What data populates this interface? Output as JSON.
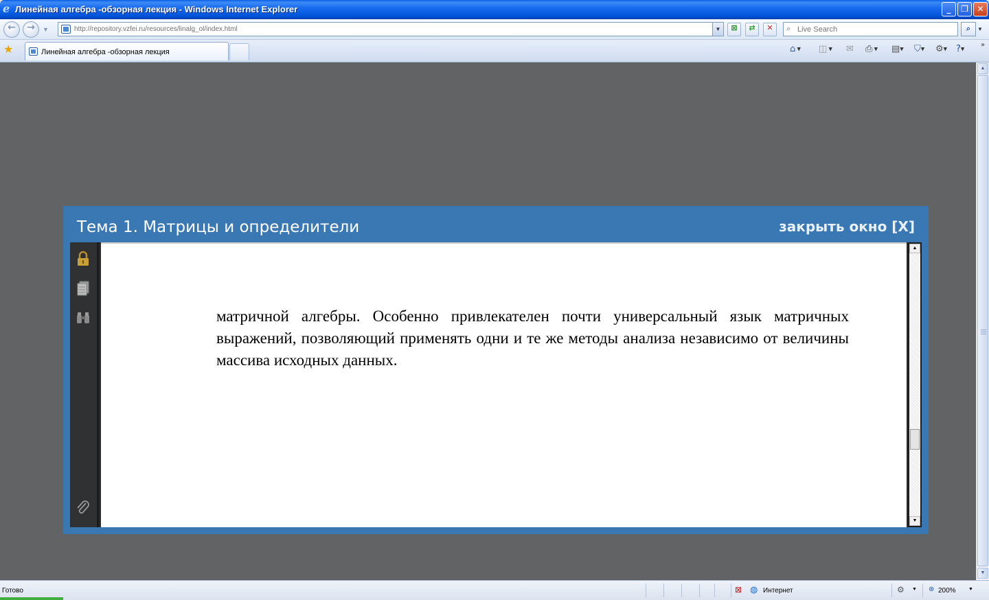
{
  "window": {
    "title": "Линейная алгебра -обзорная лекция - Windows Internet Explorer",
    "minimize_glyph": "_",
    "maximize_glyph": "❐",
    "close_glyph": "✕"
  },
  "address_bar": {
    "url": "http://repository.vzfei.ru/resources/linalg_ol/index.html",
    "search_placeholder": "Live Search"
  },
  "tabs": [
    {
      "label": "Линейная алгебра -обзорная лекция",
      "active": true
    }
  ],
  "modal": {
    "title": "Тема 1. Матрицы и определители",
    "close_label": "закрыть окно [X]"
  },
  "document": {
    "paragraph": "матричной алгебры. Особенно привлекателен почти универсальный язык матричных выражений, позволяющий применять одни и те же методы анализа независимо от величины массива исходных данных."
  },
  "status_bar": {
    "status": "Готово",
    "zone": "Интернет",
    "zoom": "200%"
  },
  "colors": {
    "modal_frame": "#3a78b4",
    "page_background": "#626365",
    "reader_sidebar": "#303132"
  },
  "icons": {
    "sidebar": [
      "lock-icon",
      "pages-icon",
      "find-icon",
      "attachment-icon"
    ],
    "command_bar": [
      "home-icon",
      "feeds-icon",
      "read-mail-icon",
      "print-icon",
      "page-icon",
      "safety-icon",
      "tools-icon",
      "help-icon"
    ]
  }
}
